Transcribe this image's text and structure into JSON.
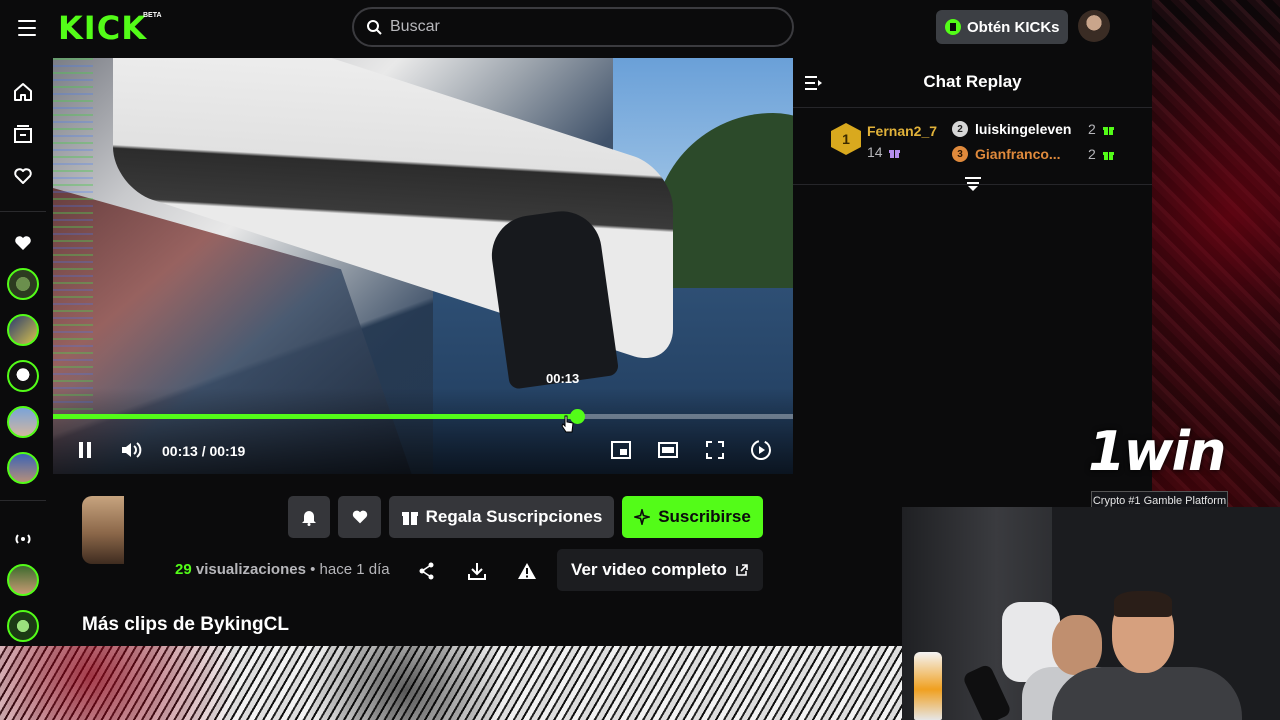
{
  "header": {
    "logo_text": "KICK",
    "logo_badge": "BETA",
    "search_placeholder": "Buscar",
    "kicks_button": "Obtén KICKs"
  },
  "player": {
    "hover_time": "00:13",
    "current_time": "00:13",
    "separator": "/",
    "duration": "00:19",
    "progress_fraction": 0.71
  },
  "chat": {
    "title": "Chat Replay",
    "top_gifter": {
      "rank": "1",
      "name": "Fernan2_7",
      "count": "14"
    },
    "gifters": [
      {
        "rank": "2",
        "name": "luiskingeleven",
        "count": "2"
      },
      {
        "rank": "3",
        "name": "Gianfranco...",
        "count": "2"
      }
    ]
  },
  "actions": {
    "gift_subs": "Regala Suscripciones",
    "subscribe": "Suscribirse",
    "full_video": "Ver video completo"
  },
  "meta": {
    "views": "29",
    "views_label": "visualizaciones",
    "dot": "•",
    "age": "hace 1 día"
  },
  "more_clips_title": "Más clips de BykingCL",
  "ad": {
    "logo": "1win",
    "tagline": "Crypto #1 Gamble Platform"
  },
  "colors": {
    "accent": "#53fc18",
    "gold": "#e1b23a",
    "bronze": "#e08a3c",
    "background": "#0b0b0c"
  }
}
